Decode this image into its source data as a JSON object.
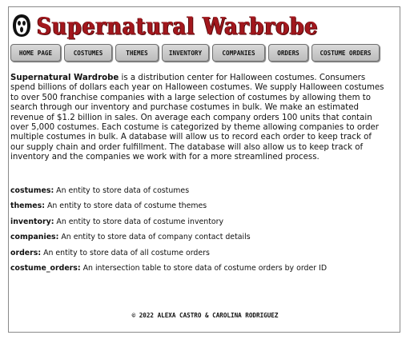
{
  "header": {
    "title": "Supernatural Warbrobe",
    "logo_icon": "ghostface-mask-icon"
  },
  "nav": [
    {
      "label": "Home Page"
    },
    {
      "label": "Costumes"
    },
    {
      "label": "Themes"
    },
    {
      "label": "Inventory"
    },
    {
      "label": "Companies"
    },
    {
      "label": "Orders"
    },
    {
      "label": "Costume Orders"
    }
  ],
  "intro": {
    "brand": "Supernatural Wardrobe",
    "text": " is a distribution center for Halloween costumes. Consumers spend billions of dollars each year on Halloween costumes. We supply Halloween costumes to over 500 franchise companies with a large selection of costumes by allowing them to search through our inventory and purchase costumes in bulk. We make an estimated revenue of $1.2 billion in sales. On average each company orders 100 units that contain over 5,000 costumes. Each costume is categorized by theme allowing companies to order multiple costumes in bulk. A database will allow us to record each order to keep track of our supply chain and order fulfillment. The database will also allow us to keep track of inventory and the companies we work with for a more streamlined process."
  },
  "entities": [
    {
      "name": "costumes:",
      "desc": " An entity to store data of costumes"
    },
    {
      "name": "themes:",
      "desc": " An entity to store data of costume themes"
    },
    {
      "name": "inventory:",
      "desc": " An entity to store data of costume inventory"
    },
    {
      "name": "companies:",
      "desc": " An entity to store data of company contact details"
    },
    {
      "name": "orders:",
      "desc": " An entity to store data of all costume orders"
    },
    {
      "name": "costume_orders:",
      "desc": " An intersection table to store data of costume orders by order ID"
    }
  ],
  "footer": {
    "text": "© 2022 Alexa Castro & Carolina Rodriguez"
  }
}
